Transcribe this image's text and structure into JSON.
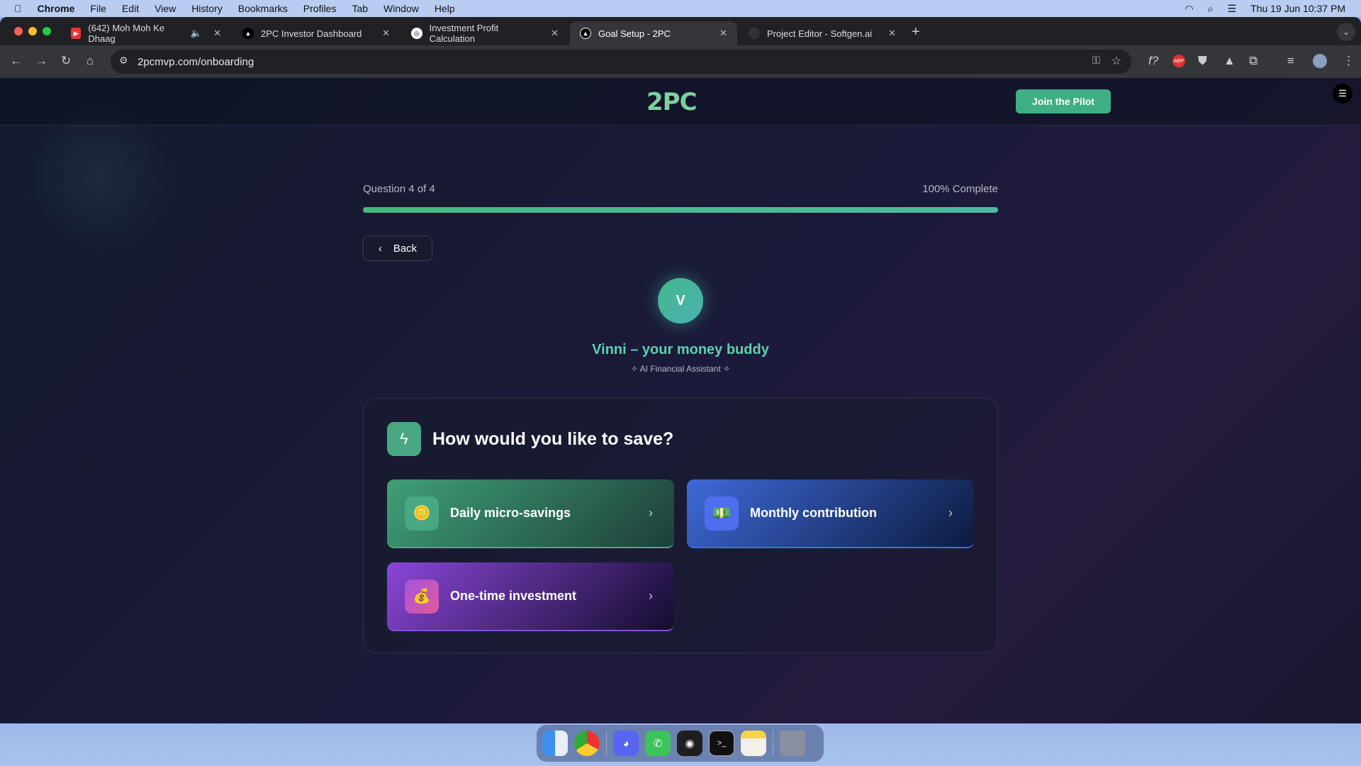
{
  "menubar": {
    "app": "Chrome",
    "items": [
      "File",
      "Edit",
      "View",
      "History",
      "Bookmarks",
      "Profiles",
      "Tab",
      "Window",
      "Help"
    ],
    "datetime": "Thu 19 Jun  10:37 PM"
  },
  "browser": {
    "tabs": [
      {
        "title": "(642) Moh Moh Ke Dhaag",
        "icon": "youtube-icon"
      },
      {
        "title": "2PC Investor Dashboard",
        "icon": "triangle-icon"
      },
      {
        "title": "Investment Profit Calculation",
        "icon": "openai-icon"
      },
      {
        "title": "Goal Setup - 2PC",
        "icon": "triangle-icon",
        "active": true
      },
      {
        "title": "Project Editor - Softgen.ai",
        "icon": "softgen-icon"
      }
    ],
    "url": "2pcmvp.com/onboarding"
  },
  "header": {
    "logo": "2PC",
    "cta": "Join the Pilot"
  },
  "progress": {
    "question_label": "Question 4 of 4",
    "complete_label": "100% Complete",
    "percent": 100
  },
  "back_label": "Back",
  "assistant": {
    "initial": "V",
    "name": "Vinni – your money buddy",
    "subtitle": "AI Financial Assistant"
  },
  "question": {
    "title": "How would you like to save?",
    "options": [
      {
        "label": "Daily micro-savings",
        "emoji": "🪙"
      },
      {
        "label": "Monthly contribution",
        "emoji": "💵"
      },
      {
        "label": "One-time investment",
        "emoji": "💰"
      }
    ]
  },
  "dock": [
    "Finder",
    "Chrome",
    "Discord",
    "WhatsApp",
    "Figma",
    "Terminal",
    "Notes",
    "Trash"
  ]
}
